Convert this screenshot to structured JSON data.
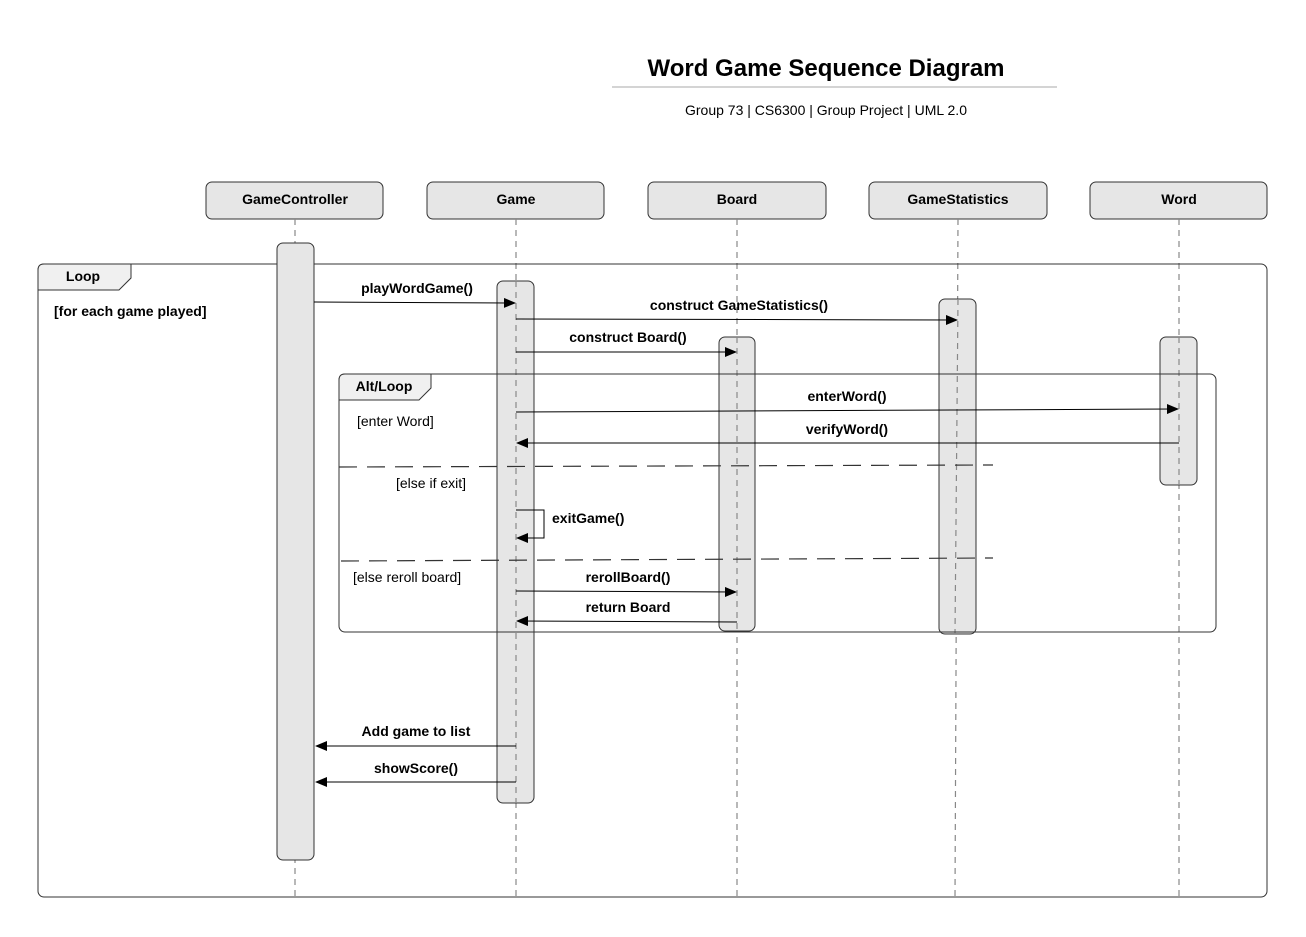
{
  "title": "Word Game Sequence Diagram",
  "subtitle": "Group 73 | CS6300 | Group Project  | UML 2.0",
  "participants": [
    "GameController",
    "Game",
    "Board",
    "GameStatistics",
    "Word"
  ],
  "frames": {
    "loop": {
      "label": "Loop",
      "guard": "[for each game played]"
    },
    "alt": {
      "label": "Alt/Loop",
      "guards": [
        "[enter Word]",
        "[else if exit]",
        "[else reroll board]"
      ]
    }
  },
  "messages": [
    {
      "label": "playWordGame()",
      "from": "GameController",
      "to": "Game"
    },
    {
      "label": "construct GameStatistics()",
      "from": "Game",
      "to": "GameStatistics"
    },
    {
      "label": "construct Board()",
      "from": "Game",
      "to": "Board"
    },
    {
      "label": "enterWord()",
      "from": "Game",
      "to": "Word"
    },
    {
      "label": "verifyWord()",
      "from": "Word",
      "to": "Game"
    },
    {
      "label": "exitGame()",
      "from": "Game",
      "to": "Game"
    },
    {
      "label": "rerollBoard()",
      "from": "Game",
      "to": "Board"
    },
    {
      "label": "return Board",
      "from": "Board",
      "to": "Game"
    },
    {
      "label": "Add game to list",
      "from": "Game",
      "to": "GameController"
    },
    {
      "label": "showScore()",
      "from": "Game",
      "to": "GameController"
    }
  ],
  "colors": {
    "box_fill": "#e6e6e6",
    "stroke": "#333333",
    "lifeline": "#888888"
  }
}
